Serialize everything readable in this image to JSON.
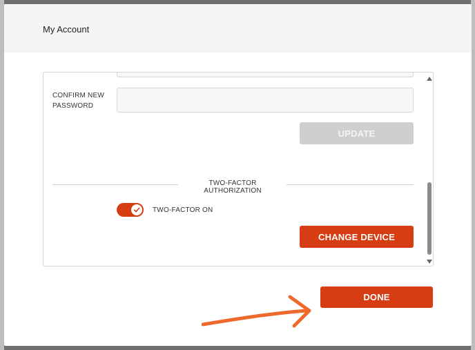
{
  "modal": {
    "title": "My Account"
  },
  "password": {
    "confirm_label": "CONFIRM NEW PASSWORD",
    "confirm_value": "",
    "update_label": "UPDATE"
  },
  "two_factor": {
    "section_title": "TWO-FACTOR AUTHORIZATION",
    "toggle_label": "TWO-FACTOR ON",
    "toggle_on": true,
    "change_device_label": "CHANGE DEVICE"
  },
  "footer": {
    "done_label": "DONE"
  },
  "colors": {
    "accent": "#d63d12",
    "disabled": "#cfcfcf",
    "annotation_arrow": "#ee6a2c"
  }
}
